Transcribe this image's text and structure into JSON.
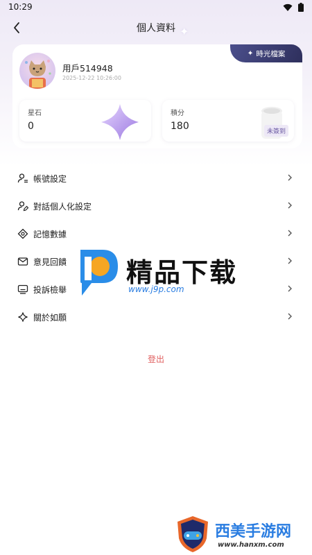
{
  "status_bar": {
    "time": "10:29"
  },
  "header": {
    "title": "個人資料",
    "time_archive_label": "時光檔案"
  },
  "profile": {
    "username": "用戶514948",
    "timestamp": "2025-12-22 10:26:00"
  },
  "stats": {
    "stones": {
      "label": "星石",
      "value": "0"
    },
    "points": {
      "label": "積分",
      "value": "180",
      "checkin_badge": "未簽到"
    }
  },
  "menu": {
    "items": [
      {
        "label": "帳號設定",
        "icon": "user-settings-icon"
      },
      {
        "label": "對話個人化設定",
        "icon": "user-edit-icon"
      },
      {
        "label": "記憶數據",
        "icon": "memory-icon"
      },
      {
        "label": "意見回饋",
        "icon": "mail-icon"
      },
      {
        "label": "投訴檢舉",
        "icon": "report-icon"
      },
      {
        "label": "關於如願",
        "icon": "sparkle-icon"
      }
    ]
  },
  "logout_label": "登出",
  "watermarks": {
    "primary_title": "精品下载",
    "primary_url": "www.j9p.com",
    "secondary_title": "西美手游网",
    "secondary_url": "www.hanxm.com"
  },
  "colors": {
    "accent_dark": "#2e2f5c",
    "logout": "#e06060",
    "checkin_badge_bg": "#ede8f6",
    "star_purple": "#b89be8"
  }
}
